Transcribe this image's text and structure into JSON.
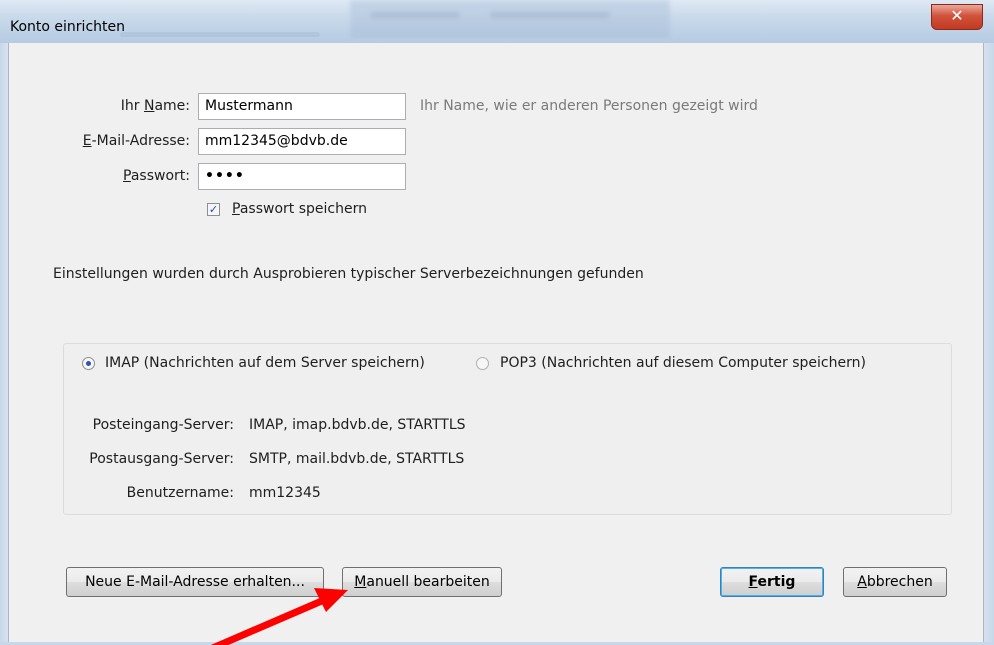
{
  "window": {
    "title": "Konto einrichten",
    "close_glyph": "✕"
  },
  "form": {
    "name": {
      "label_pre": "Ihr ",
      "label_ul": "N",
      "label_post": "ame:",
      "value": "Mustermann",
      "hint": "Ihr Name, wie er anderen Personen gezeigt wird"
    },
    "email": {
      "label_pre": "",
      "label_ul": "E",
      "label_post": "-Mail-Adresse:",
      "value": "mm12345@bdvb.de"
    },
    "password": {
      "label_pre": "",
      "label_ul": "P",
      "label_post": "asswort:",
      "value": "••••"
    },
    "save_password": {
      "checked": true,
      "label_ul": "P",
      "label_post": "asswort speichern"
    }
  },
  "info_text": "Einstellungen wurden durch Ausprobieren typischer Serverbezeichnungen gefunden",
  "protocol": {
    "imap": {
      "label": "IMAP (Nachrichten auf dem Server speichern)",
      "selected": true
    },
    "pop3": {
      "label": "POP3 (Nachrichten auf diesem Computer speichern)",
      "selected": false
    }
  },
  "servers": [
    {
      "label": "Posteingang-Server:",
      "value": "IMAP, imap.bdvb.de, STARTTLS"
    },
    {
      "label": "Postausgang-Server:",
      "value": "SMTP, mail.bdvb.de, STARTTLS"
    },
    {
      "label": "Benutzername:",
      "value": "mm12345"
    }
  ],
  "buttons": {
    "new_email": "Neue E-Mail-Adresse erhalten...",
    "manual_ul": "M",
    "manual_post": "anuell bearbeiten",
    "done_ul": "F",
    "done_post": "ertig",
    "cancel_ul": "A",
    "cancel_post": "bbrechen"
  },
  "colors": {
    "annotation_arrow": "#ff0000",
    "title_bar": "#c7d8ea",
    "close_button": "#c8442b"
  },
  "icons": {
    "checkbox": "check-icon",
    "radio": "radio-icon",
    "arrow": "red-annotation-arrow"
  }
}
